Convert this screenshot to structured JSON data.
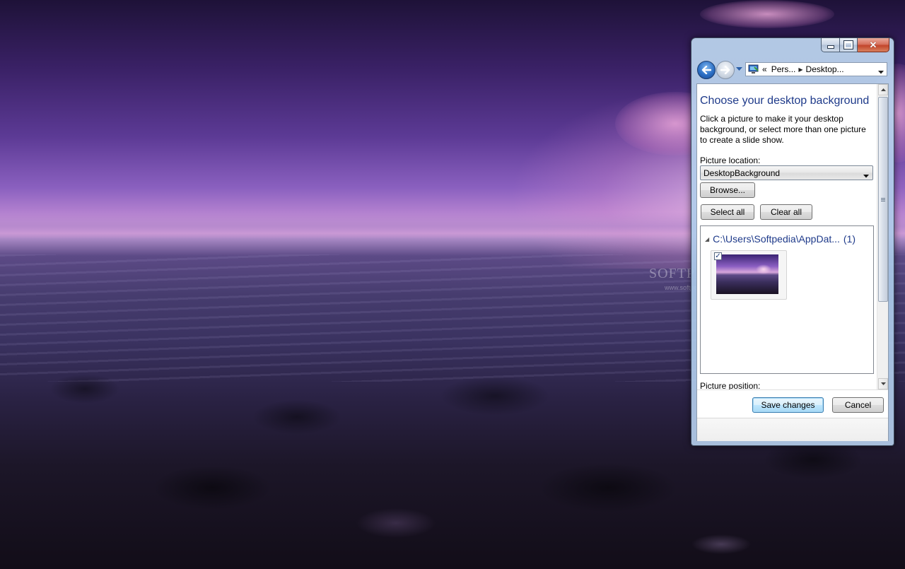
{
  "desktop": {
    "watermark": "SOFTPEDIA",
    "watermark_url": "www.softpedia.com"
  },
  "window": {
    "caption_buttons": [
      "minimize",
      "maximize",
      "close"
    ],
    "close_glyph": "✕",
    "nav": {
      "address_overflow": "«",
      "breadcrumbs": [
        "Pers...",
        "Desktop..."
      ]
    },
    "content": {
      "title": "Choose your desktop background",
      "description": "Click a picture to make it your desktop background, or select more than one picture to create a slide show.",
      "location_label": "Picture location:",
      "location_value": "DesktopBackground",
      "browse_label": "Browse...",
      "select_all_label": "Select all",
      "clear_all_label": "Clear all",
      "group_path": "C:\\Users\\Softpedia\\AppDat...",
      "group_count": "(1)",
      "thumbnail_checked": "✓",
      "position_label": "Picture position:"
    },
    "buttons": {
      "save": "Save changes",
      "cancel": "Cancel"
    }
  },
  "colors": {
    "title_blue": "#1e3a8a",
    "close_red": "#c2462b",
    "accent_blue": "#2c6fc4"
  }
}
